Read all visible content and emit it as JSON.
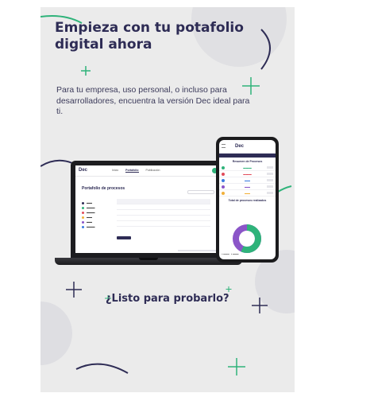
{
  "hero": {
    "headline": "Empieza con tu potafolio digital ahora",
    "intro": "Para tu empresa, uso personal, o incluso para desarrolladores, encuentra la versión Dec ideal para ti.",
    "cta": "¿Listo para probarlo?"
  },
  "brand": {
    "logo": "Dec",
    "colors": {
      "navy": "#2e2c55",
      "green": "#2fb37a",
      "purple": "#8b55c8",
      "background": "#ebebeb"
    }
  },
  "laptop": {
    "nav": [
      "Inicio",
      "Portafolio",
      "Publicación"
    ],
    "page_title": "Portafolio de procesos"
  },
  "phone": {
    "section_title": "Resumen de Procesos",
    "chart_title": "Total de procesos realizados"
  },
  "icons": [
    "sparkle-icon",
    "plus-icon"
  ]
}
